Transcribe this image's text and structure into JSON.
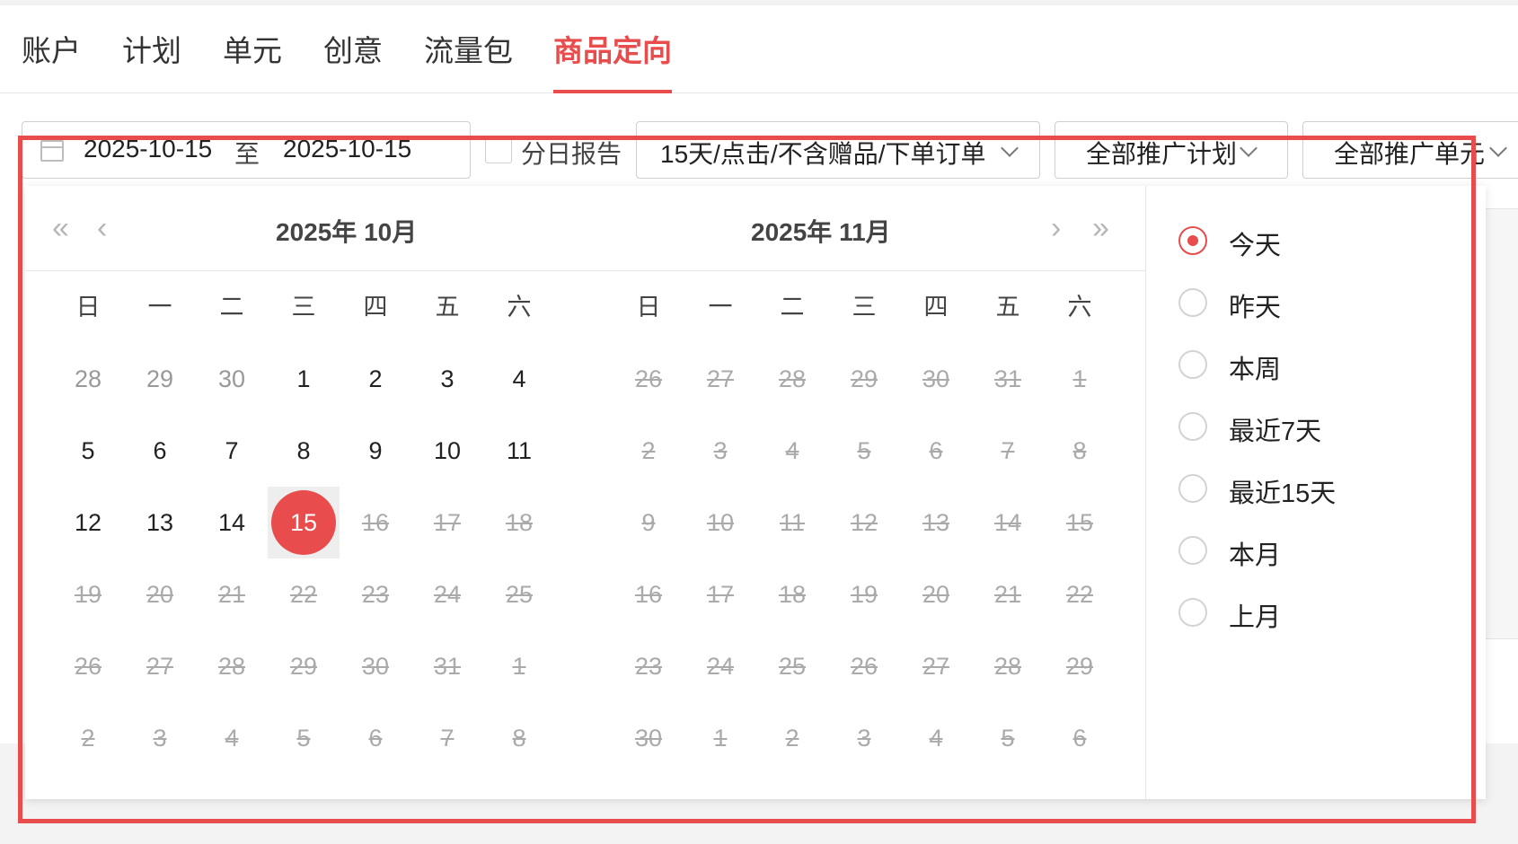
{
  "tabs": [
    {
      "label": "账户",
      "active": false
    },
    {
      "label": "计划",
      "active": false
    },
    {
      "label": "单元",
      "active": false
    },
    {
      "label": "创意",
      "active": false
    },
    {
      "label": "流量包",
      "active": false
    },
    {
      "label": "商品定向",
      "active": true
    }
  ],
  "toolbar": {
    "date_start": "2025-10-15",
    "date_sep": "至",
    "date_end": "2025-10-15",
    "daily_report_label": "分日报告",
    "attribution_select": "15天/点击/不含赠品/下单订单",
    "plan_select": "全部推广计划",
    "unit_select": "全部推广单元"
  },
  "picker": {
    "nav": {
      "prev_year": "«",
      "prev_month": "‹",
      "next_month": "›",
      "next_year": "»"
    },
    "weekdays": [
      "日",
      "一",
      "二",
      "三",
      "四",
      "五",
      "六"
    ],
    "months": [
      {
        "title": "2025年 10月",
        "days": [
          {
            "d": "28",
            "s": "other"
          },
          {
            "d": "29",
            "s": "other"
          },
          {
            "d": "30",
            "s": "other"
          },
          {
            "d": "1",
            "s": "cur"
          },
          {
            "d": "2",
            "s": "cur"
          },
          {
            "d": "3",
            "s": "cur"
          },
          {
            "d": "4",
            "s": "cur"
          },
          {
            "d": "5",
            "s": "cur"
          },
          {
            "d": "6",
            "s": "cur"
          },
          {
            "d": "7",
            "s": "cur"
          },
          {
            "d": "8",
            "s": "cur"
          },
          {
            "d": "9",
            "s": "cur"
          },
          {
            "d": "10",
            "s": "cur"
          },
          {
            "d": "11",
            "s": "cur"
          },
          {
            "d": "12",
            "s": "cur"
          },
          {
            "d": "13",
            "s": "cur"
          },
          {
            "d": "14",
            "s": "cur"
          },
          {
            "d": "15",
            "s": "selected"
          },
          {
            "d": "16",
            "s": "disabled"
          },
          {
            "d": "17",
            "s": "disabled"
          },
          {
            "d": "18",
            "s": "disabled"
          },
          {
            "d": "19",
            "s": "disabled"
          },
          {
            "d": "20",
            "s": "disabled"
          },
          {
            "d": "21",
            "s": "disabled"
          },
          {
            "d": "22",
            "s": "disabled"
          },
          {
            "d": "23",
            "s": "disabled"
          },
          {
            "d": "24",
            "s": "disabled"
          },
          {
            "d": "25",
            "s": "disabled"
          },
          {
            "d": "26",
            "s": "disabled"
          },
          {
            "d": "27",
            "s": "disabled"
          },
          {
            "d": "28",
            "s": "disabled"
          },
          {
            "d": "29",
            "s": "disabled"
          },
          {
            "d": "30",
            "s": "disabled"
          },
          {
            "d": "31",
            "s": "disabled"
          },
          {
            "d": "1",
            "s": "disabled"
          },
          {
            "d": "2",
            "s": "disabled"
          },
          {
            "d": "3",
            "s": "disabled"
          },
          {
            "d": "4",
            "s": "disabled"
          },
          {
            "d": "5",
            "s": "disabled"
          },
          {
            "d": "6",
            "s": "disabled"
          },
          {
            "d": "7",
            "s": "disabled"
          },
          {
            "d": "8",
            "s": "disabled"
          }
        ]
      },
      {
        "title": "2025年 11月",
        "days": [
          {
            "d": "26",
            "s": "disabled"
          },
          {
            "d": "27",
            "s": "disabled"
          },
          {
            "d": "28",
            "s": "disabled"
          },
          {
            "d": "29",
            "s": "disabled"
          },
          {
            "d": "30",
            "s": "disabled"
          },
          {
            "d": "31",
            "s": "disabled"
          },
          {
            "d": "1",
            "s": "disabled"
          },
          {
            "d": "2",
            "s": "disabled"
          },
          {
            "d": "3",
            "s": "disabled"
          },
          {
            "d": "4",
            "s": "disabled"
          },
          {
            "d": "5",
            "s": "disabled"
          },
          {
            "d": "6",
            "s": "disabled"
          },
          {
            "d": "7",
            "s": "disabled"
          },
          {
            "d": "8",
            "s": "disabled"
          },
          {
            "d": "9",
            "s": "disabled"
          },
          {
            "d": "10",
            "s": "disabled"
          },
          {
            "d": "11",
            "s": "disabled"
          },
          {
            "d": "12",
            "s": "disabled"
          },
          {
            "d": "13",
            "s": "disabled"
          },
          {
            "d": "14",
            "s": "disabled"
          },
          {
            "d": "15",
            "s": "disabled"
          },
          {
            "d": "16",
            "s": "disabled"
          },
          {
            "d": "17",
            "s": "disabled"
          },
          {
            "d": "18",
            "s": "disabled"
          },
          {
            "d": "19",
            "s": "disabled"
          },
          {
            "d": "20",
            "s": "disabled"
          },
          {
            "d": "21",
            "s": "disabled"
          },
          {
            "d": "22",
            "s": "disabled"
          },
          {
            "d": "23",
            "s": "disabled"
          },
          {
            "d": "24",
            "s": "disabled"
          },
          {
            "d": "25",
            "s": "disabled"
          },
          {
            "d": "26",
            "s": "disabled"
          },
          {
            "d": "27",
            "s": "disabled"
          },
          {
            "d": "28",
            "s": "disabled"
          },
          {
            "d": "29",
            "s": "disabled"
          },
          {
            "d": "30",
            "s": "disabled"
          },
          {
            "d": "1",
            "s": "disabled"
          },
          {
            "d": "2",
            "s": "disabled"
          },
          {
            "d": "3",
            "s": "disabled"
          },
          {
            "d": "4",
            "s": "disabled"
          },
          {
            "d": "5",
            "s": "disabled"
          },
          {
            "d": "6",
            "s": "disabled"
          }
        ]
      }
    ],
    "quick_ranges": [
      {
        "label": "今天",
        "checked": true
      },
      {
        "label": "昨天",
        "checked": false
      },
      {
        "label": "本周",
        "checked": false
      },
      {
        "label": "最近7天",
        "checked": false
      },
      {
        "label": "最近15天",
        "checked": false
      },
      {
        "label": "本月",
        "checked": false
      },
      {
        "label": "上月",
        "checked": false
      }
    ]
  },
  "colors": {
    "accent": "#e84c4c",
    "annotation": "#e84c4c"
  }
}
